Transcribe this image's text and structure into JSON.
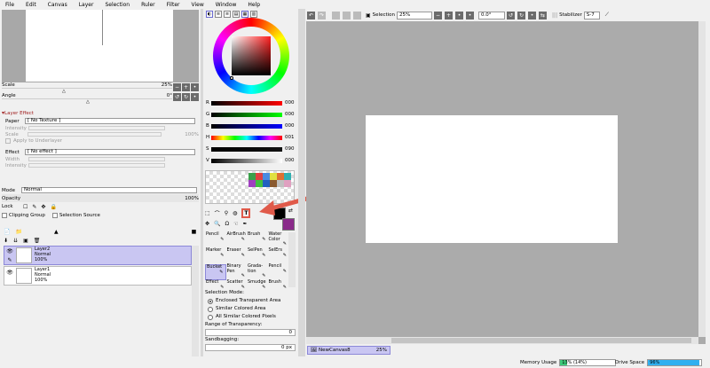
{
  "menu": [
    "File",
    "Edit",
    "Canvas",
    "Layer",
    "Selection",
    "Ruler",
    "Filter",
    "View",
    "Window",
    "Help"
  ],
  "navigator": {
    "scale_label": "Scale",
    "scale_value": "25%",
    "angle_label": "Angle",
    "angle_value": "0°"
  },
  "layer_effect": {
    "header": "Layer Effect",
    "paper_label": "Paper",
    "paper_value": "[ No Texture ]",
    "intensity1": "Intensity",
    "scale_label": "Scale",
    "scale_value": "100%",
    "apply_underlayer": "Apply to Underlayer",
    "effect_label": "Effect",
    "effect_value": "[ No effect ]",
    "width_label": "Width",
    "intensity2": "Intensity"
  },
  "layer_props": {
    "mode_label": "Mode",
    "mode_value": "Normal",
    "opacity_label": "Opacity",
    "opacity_value": "100%",
    "lock_label": "Lock",
    "clipping_group": "Clipping Group",
    "selection_source": "Selection Source"
  },
  "layers": [
    {
      "name": "Layer2",
      "mode": "Normal",
      "opacity": "100%",
      "selected": true
    },
    {
      "name": "Layer1",
      "mode": "Normal",
      "opacity": "100%",
      "selected": false
    }
  ],
  "color": {
    "sliders": [
      {
        "label": "R",
        "value": "000"
      },
      {
        "label": "G",
        "value": "000"
      },
      {
        "label": "B",
        "value": "000"
      },
      {
        "label": "H",
        "value": "001"
      },
      {
        "label": "S",
        "value": "090"
      },
      {
        "label": "V",
        "value": "000"
      }
    ],
    "primary": "#000000",
    "secondary": "#8a2a8a",
    "accent_arrow": "#e05a4a"
  },
  "swatches": [
    "#3aa04a",
    "#e04040",
    "#4a8ae0",
    "#e0e040",
    "#e07030",
    "#30b0b0",
    "#a040c0",
    "#40c040",
    "#2060c0",
    "#8a5a30",
    "#c0c0c0",
    "#e0a0c0"
  ],
  "tools": [
    {
      "label": "Pencil"
    },
    {
      "label": "AirBrush"
    },
    {
      "label": "Brush"
    },
    {
      "label": "Water Color"
    },
    {
      "label": "Marker"
    },
    {
      "label": "Eraser"
    },
    {
      "label": "SelPen"
    },
    {
      "label": "SelErs"
    },
    {
      "label": "Bucket"
    },
    {
      "label": "Binary Pen"
    },
    {
      "label": "Grada-tion"
    },
    {
      "label": "Pencil"
    },
    {
      "label": "Effect"
    },
    {
      "label": "Scatter"
    },
    {
      "label": "Smudge"
    },
    {
      "label": "Brush"
    }
  ],
  "tool_options": {
    "selection_mode": "Selection Mode:",
    "opt1": "Enclosed Transparent Area",
    "opt2": "Similar Colored Area",
    "opt3": "All Similar Colored Pixels",
    "range_label": "Range of Transparency:",
    "range_value": "0",
    "sandbagging_label": "Sandbagging:",
    "sandbagging_value": "0 px"
  },
  "toolbar": {
    "selection_label": "Selection",
    "zoom_value": "25%",
    "angle_value": "0.0°",
    "stabilizer_label": "Stabilizer",
    "stabilizer_value": "S-7"
  },
  "canvas_tab": {
    "name": "NewCanvas8",
    "zoom": "25%"
  },
  "status": {
    "memory_label": "Memory Usage",
    "memory_value": "13% (14%)",
    "memory_pct": 13,
    "drive_label": "Drive Space",
    "drive_value": "96%",
    "drive_pct": 96
  }
}
